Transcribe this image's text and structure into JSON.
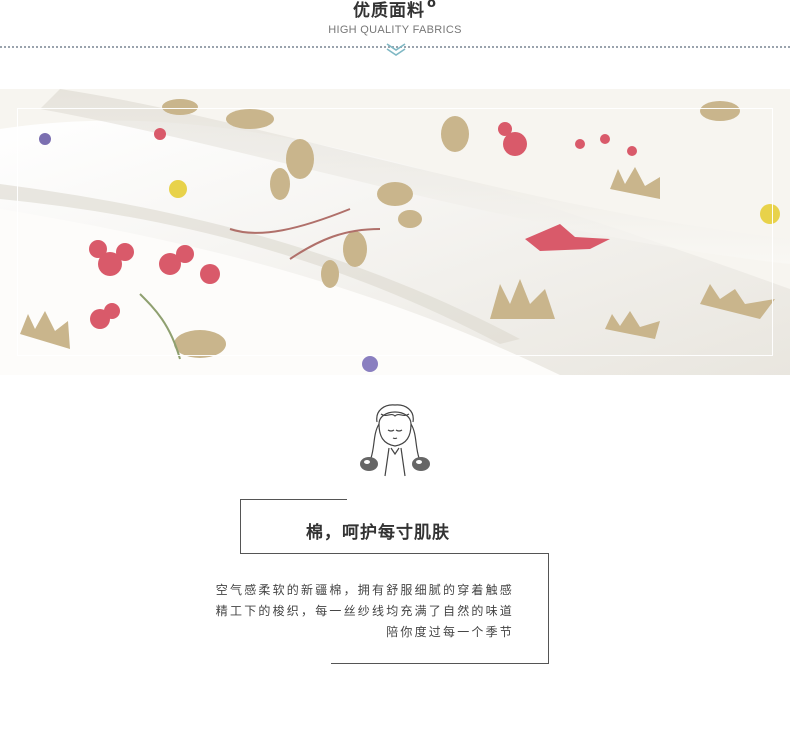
{
  "header": {
    "title": "优质面料",
    "title_mark": "o",
    "subtitle": "HIGH QUALITY FABRICS"
  },
  "section": {
    "heading": "棉，呵护每寸肌肤",
    "lines": [
      "空气感柔软的新疆棉，拥有舒服细腻的穿着触感",
      "精工下的梭织，每一丝纱线均充满了自然的味道",
      "陪你度过每一个季节"
    ]
  },
  "colors": {
    "text_dark": "#333333",
    "text_body": "#444444",
    "line": "#555555",
    "accent_teal": "#7fb8c4",
    "flower_pink": "#d95a6a",
    "leaf_tan": "#c9b58c"
  }
}
